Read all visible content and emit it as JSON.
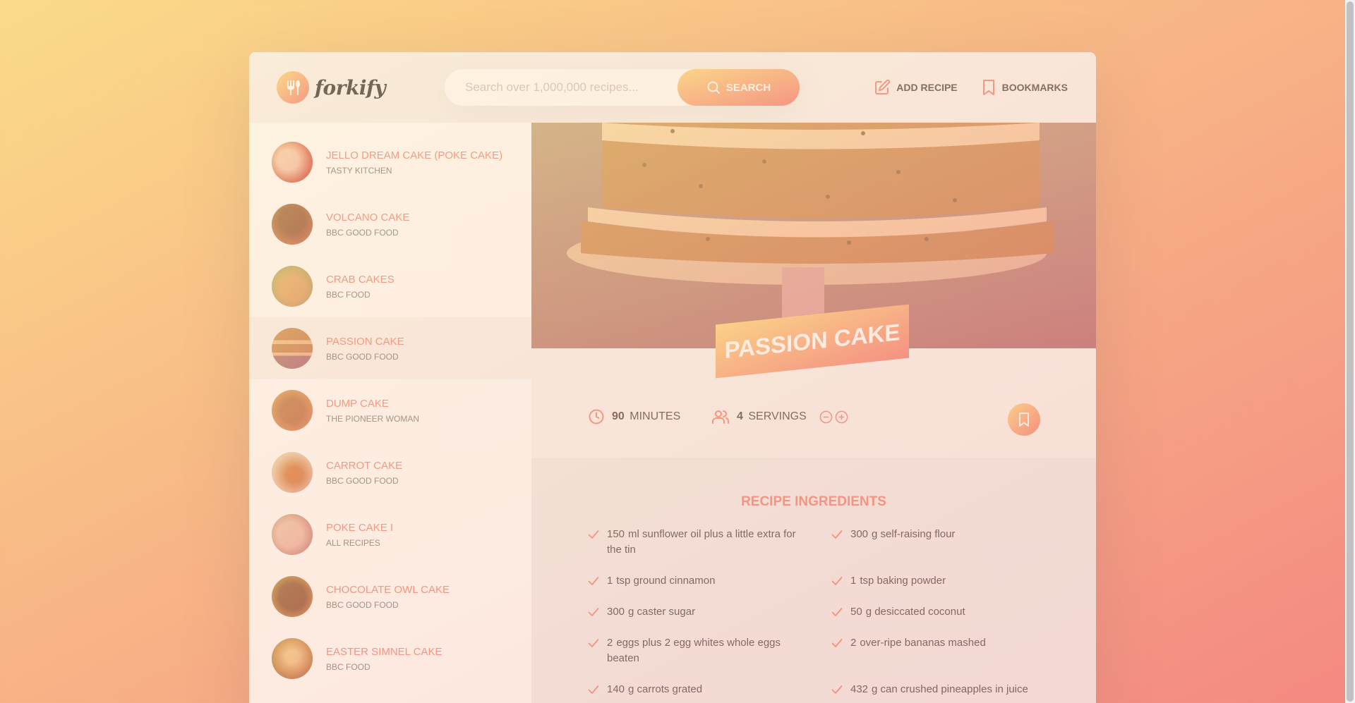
{
  "brand": {
    "name": "forkify"
  },
  "search": {
    "placeholder": "Search over 1,000,000 recipes...",
    "button_label": "Search"
  },
  "nav": {
    "add_recipe": "Add recipe",
    "bookmarks": "Bookmarks"
  },
  "results": [
    {
      "title": "Jello Dream Cake (Poke Cake)",
      "publisher": "Tasty Kitchen",
      "thumb": [
        "#f5d9d0",
        "#c8433a"
      ]
    },
    {
      "title": "Volcano Cake",
      "publisher": "BBC Good Food",
      "thumb": [
        "#6b3a23",
        "#b1683d"
      ]
    },
    {
      "title": "Crab Cakes",
      "publisher": "BBC Food",
      "thumb": [
        "#d7aa62",
        "#7fa45a"
      ]
    },
    {
      "title": "Passion Cake",
      "publisher": "BBC Good Food",
      "thumb": [
        "#b3753f",
        "#e9c49a"
      ]
    },
    {
      "title": "Dump Cake",
      "publisher": "The Pioneer Woman",
      "thumb": [
        "#a15a32",
        "#d28b4e"
      ]
    },
    {
      "title": "Carrot Cake",
      "publisher": "BBC Good Food",
      "thumb": [
        "#e2d3c4",
        "#c5682a"
      ]
    },
    {
      "title": "Poke Cake I",
      "publisher": "All Recipes",
      "thumb": [
        "#e7c8c8",
        "#a76f77"
      ]
    },
    {
      "title": "Chocolate Owl Cake",
      "publisher": "BBC Good Food",
      "thumb": [
        "#5b2f17",
        "#c28a3a"
      ]
    },
    {
      "title": "Easter Simnel Cake",
      "publisher": "BBC Food",
      "thumb": [
        "#b27a37",
        "#f0d392"
      ]
    }
  ],
  "recipe": {
    "title": "Passion Cake",
    "cooking_time": "90",
    "cooking_time_unit": "minutes",
    "servings": "4",
    "servings_unit": "servings",
    "ingredients_heading": "Recipe ingredients",
    "ingredients": [
      {
        "qty": "150",
        "text": "ml sunflower oil plus a little extra for the tin"
      },
      {
        "qty": "300",
        "text": "g self-raising flour"
      },
      {
        "qty": "1",
        "text": "tsp ground cinnamon"
      },
      {
        "qty": "1",
        "text": "tsp baking powder"
      },
      {
        "qty": "300",
        "text": "g caster sugar"
      },
      {
        "qty": "50",
        "text": "g desiccated coconut"
      },
      {
        "qty": "2",
        "text": "eggs plus 2 egg whites whole eggs beaten"
      },
      {
        "qty": "2",
        "text": "over-ripe bananas mashed"
      },
      {
        "qty": "140",
        "text": "g carrots grated"
      },
      {
        "qty": "432",
        "text": "g can crushed pineapples in juice"
      }
    ]
  },
  "colors": {
    "accent": "#f38e82",
    "gradient_start": "#fbdb89",
    "gradient_end": "#f48982",
    "text": "#615551",
    "panel": "#f9f5f3"
  },
  "icons": {
    "search": "search-icon",
    "edit": "edit-icon",
    "bookmark": "bookmark-icon",
    "clock": "clock-icon",
    "users": "users-icon",
    "minus": "minus-circle-icon",
    "plus": "plus-circle-icon",
    "check": "check-icon"
  }
}
